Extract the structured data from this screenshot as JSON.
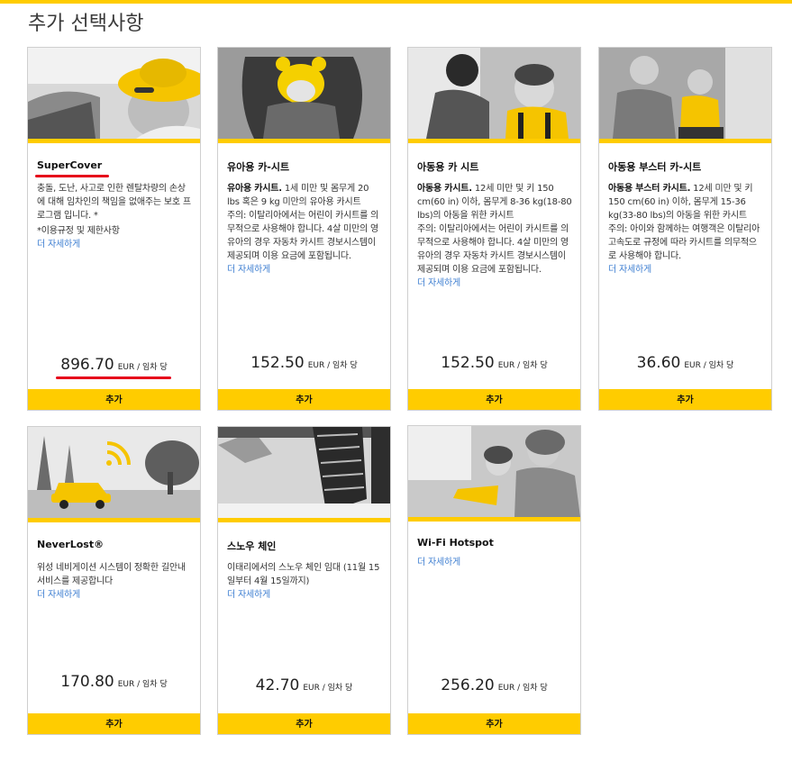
{
  "page": {
    "title": "추가 선택사항"
  },
  "colors": {
    "accent": "#ffcc00",
    "link": "#3d7ed1",
    "highlight": "#e6001a"
  },
  "cards": [
    {
      "title": "SuperCover",
      "desc_bold": "",
      "desc_text": "충돌, 도난, 사고로 인한 렌탈차량의 손상에 대해 임차인의 책임을 없애주는 보호 프로그램 입니다. *",
      "note": "*이용규정 및 제한사항",
      "more": "더 자세하게",
      "price": "896.70",
      "unit": "EUR / 임차 당",
      "add": "추가",
      "icon": "woman-sunhat-photo"
    },
    {
      "title": "유아용 카-시트",
      "desc_bold": "유아용 카시트.",
      "desc_text": " 1세 미만 및 몸무게 20 lbs 혹은 9 kg 미만의 유아용 카시트",
      "note": "주의: 이탈리아에서는 어린이 카시트를 의무적으로 사용해야 합니다. 4살 미만의 영유아의 경우 자동차 카시트 경보시스템이 제공되며 이용 요금에 포함됩니다.",
      "more": "더 자세하게",
      "price": "152.50",
      "unit": "EUR / 임차 당",
      "add": "추가",
      "icon": "infant-seat-photo"
    },
    {
      "title": "아동용 카 시트",
      "desc_bold": "아동용 카시트.",
      "desc_text": " 12세 미만 및 키 150 cm(60 in) 이하, 몸무게 8-36 kg(18-80 lbs)의 아동을 위한 카시트",
      "note": "주의: 이탈리아에서는 어린이 카시트를 의무적으로 사용해야 합니다. 4살 미만의 영유아의 경우 자동차 카시트 경보시스템이 제공되며 이용 요금에 포함됩니다.",
      "more": "더 자세하게",
      "price": "152.50",
      "unit": "EUR / 임차 당",
      "add": "추가",
      "icon": "child-seat-photo"
    },
    {
      "title": "아동용 부스터 카-시트",
      "desc_bold": "아동용 부스터 카시트.",
      "desc_text": " 12세 미만 및 키 150 cm(60 in) 이하, 몸무게 15-36 kg(33-80 lbs)의 아동을 위한 카시트",
      "note": "주의: 아이와 함께하는 여행객은 이탈리아 고속도로 규정에 따라 카시트를 의무적으로 사용해야 합니다.",
      "more": "더 자세하게",
      "price": "36.60",
      "unit": "EUR / 임차 당",
      "add": "추가",
      "icon": "booster-seat-photo"
    },
    {
      "title": "NeverLost®",
      "desc_bold": "",
      "desc_text": "위성 네비게이션 시스템이 정확한 길안내 서비스를 제공합니다",
      "note": "",
      "more": "더 자세하게",
      "price": "170.80",
      "unit": "EUR / 임차 당",
      "add": "추가",
      "icon": "yellow-car-photo"
    },
    {
      "title": "스노우 체인",
      "desc_bold": "",
      "desc_text": "이태리에서의 스노우 체인 임대 (11월 15일부터 4월 15일까지)",
      "note": "",
      "more": "더 자세하게",
      "price": "42.70",
      "unit": "EUR / 임차 당",
      "add": "추가",
      "icon": "snow-chain-photo"
    },
    {
      "title": "Wi-Fi Hotspot",
      "desc_bold": "",
      "desc_text": "",
      "note": "",
      "more": "더 자세하게",
      "price": "256.20",
      "unit": "EUR / 임차 당",
      "add": "추가",
      "icon": "tablet-kids-photo"
    }
  ]
}
